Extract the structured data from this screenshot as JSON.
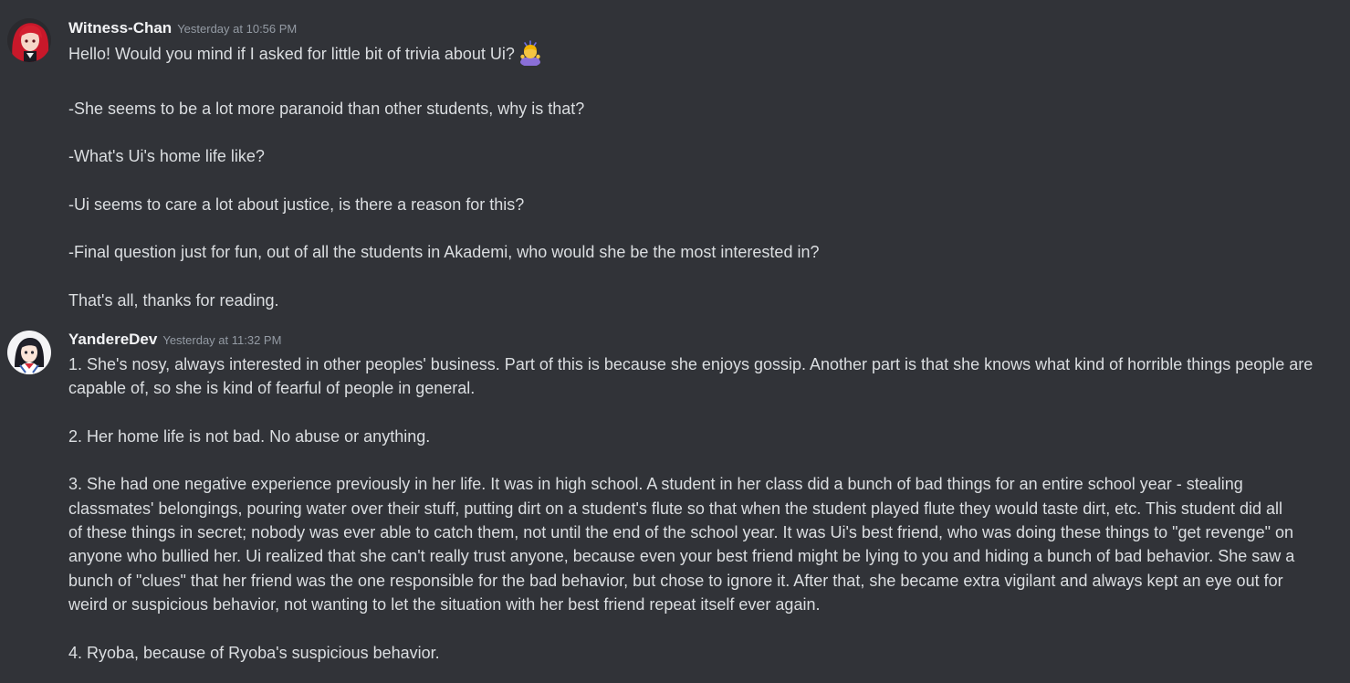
{
  "messages": [
    {
      "username": "Witness-Chan",
      "timestamp": "Yesterday at 10:56 PM",
      "avatar_icon": "red-haired-girl-avatar-icon",
      "lines": [
        "Hello! Would you mind if I asked for little bit of trivia about Ui?",
        "",
        "-She seems to be a lot more paranoid than other students, why is that?",
        "",
        "-What's Ui's home life like?",
        "",
        "-Ui seems to care a lot about justice, is there a reason for this?",
        "",
        "-Final question just for fun, out of all the students in Akademi, who would she be the most interested in?",
        "",
        "That's all, thanks for reading."
      ],
      "emoji": "person-bowing-emoji-icon"
    },
    {
      "username": "YandereDev",
      "timestamp": "Yesterday at 11:32 PM",
      "avatar_icon": "anime-schoolgirl-avatar-icon",
      "lines": [
        "1. She's nosy, always interested in other peoples' business. Part of this is because she enjoys gossip. Another part is that she knows what kind of horrible things people are",
        "capable of, so she is kind of fearful of people in general.",
        "",
        "2. Her home life is not bad. No abuse or anything.",
        "",
        "3. She had one negative experience previously in her life. It was in high school. A student in her class did a bunch of bad things for an entire school year - stealing",
        "classmates' belongings, pouring water over their stuff, putting dirt on a student's flute so that when the student played flute they would taste dirt, etc. This student did all",
        "of these things in secret; nobody was ever able to catch them, not until the end of the school year. It was Ui's best friend, who was doing these things to \"get revenge\" on",
        "anyone who bullied her. Ui realized that she can't really trust anyone, because even your best friend might be lying to you and hiding a bunch of bad behavior. She saw a",
        "bunch of \"clues\" that her friend was the one responsible for the bad behavior, but chose to ignore it. After that, she became extra vigilant and always kept an eye out for",
        "weird or suspicious behavior, not wanting to let the situation with her best friend repeat itself ever again.",
        "",
        "4. Ryoba, because of Ryoba's suspicious behavior."
      ]
    }
  ]
}
